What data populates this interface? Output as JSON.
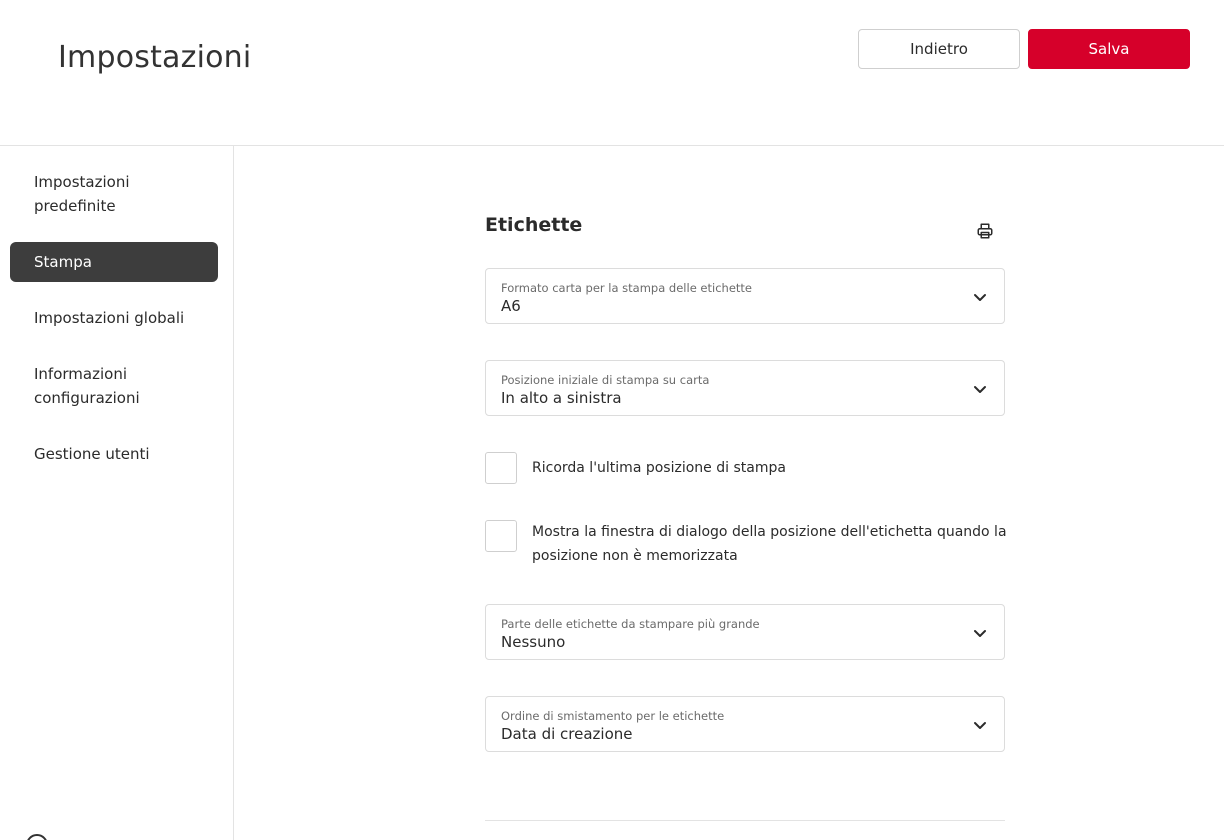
{
  "header": {
    "title": "Impostazioni",
    "back_label": "Indietro",
    "save_label": "Salva"
  },
  "sidebar": {
    "items": [
      {
        "label": "Impostazioni predefinite",
        "active": false
      },
      {
        "label": "Stampa",
        "active": true
      },
      {
        "label": "Impostazioni globali",
        "active": false
      },
      {
        "label": "Informazioni configurazioni",
        "active": false
      },
      {
        "label": "Gestione utenti",
        "active": false
      }
    ]
  },
  "content": {
    "section_title": "Etichette",
    "paper_format": {
      "label": "Formato carta per la stampa delle etichette",
      "value": "A6"
    },
    "start_position": {
      "label": "Posizione iniziale di stampa su carta",
      "value": "In alto a sinistra"
    },
    "remember_position": {
      "label": "Ricorda l'ultima posizione di stampa",
      "checked": false
    },
    "show_dialog": {
      "label": "Mostra la finestra di dialogo della posizione dell'etichetta quando la posizione non è memorizzata",
      "checked": false
    },
    "large_part": {
      "label": "Parte delle etichette da stampare più grande",
      "value": "Nessuno"
    },
    "sort_order": {
      "label": "Ordine di smistamento per le etichette",
      "value": "Data di creazione"
    }
  },
  "colors": {
    "accent": "#d6002a",
    "active_nav": "#3d3d3d",
    "border": "#dcdcdc"
  },
  "icons": {
    "print": "printer-icon",
    "chevron": "chevron-down-icon",
    "help": "help-icon"
  }
}
